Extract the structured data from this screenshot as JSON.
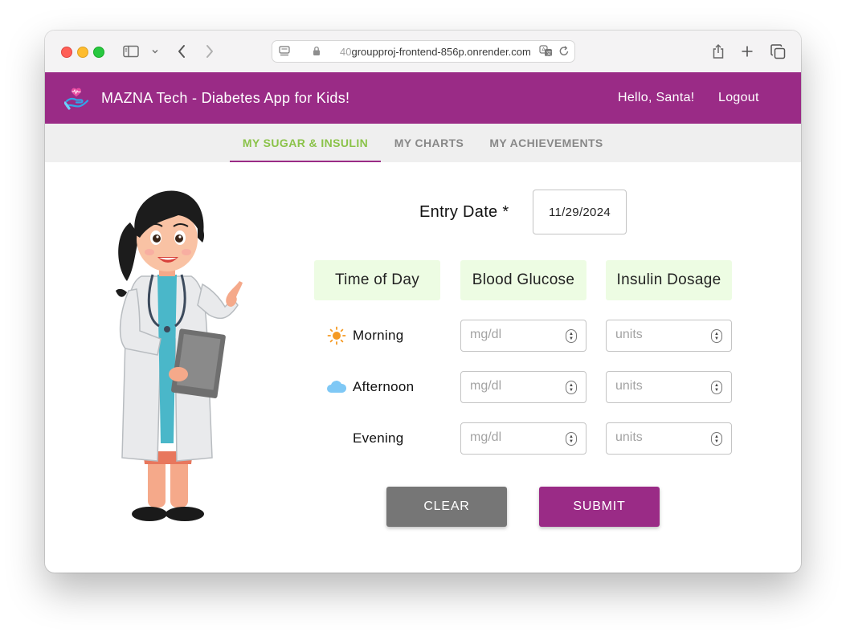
{
  "browser": {
    "url_prefix": "40",
    "url_host": "groupproj-frontend-856p.onrender.com",
    "icons": [
      "sidebar-icon",
      "chevron-down-icon",
      "back-arrow-icon",
      "forward-arrow-icon",
      "page-settings-icon",
      "lock-icon",
      "translate-icon",
      "reload-icon",
      "share-icon",
      "new-tab-icon",
      "tab-overview-icon"
    ]
  },
  "header": {
    "title": "MAZNA Tech - Diabetes App for Kids!",
    "greeting": "Hello, Santa!",
    "logout_label": "Logout",
    "color": "#9a2b86",
    "logo_icon": "heart-in-hand-icon"
  },
  "tabs": [
    {
      "label": "MY SUGAR & INSULIN",
      "active": true
    },
    {
      "label": "MY CHARTS",
      "active": false
    },
    {
      "label": "MY ACHIEVEMENTS",
      "active": false
    }
  ],
  "form": {
    "entry_date_label": "Entry Date *",
    "entry_date_value": "11/29/2024",
    "columns": [
      "Time of Day",
      "Blood Glucose",
      "Insulin Dosage"
    ],
    "rows": [
      {
        "label": "Morning",
        "icon": "sun-icon",
        "glucose_placeholder": "mg/dl",
        "insulin_placeholder": "units"
      },
      {
        "label": "Afternoon",
        "icon": "cloud-icon",
        "glucose_placeholder": "mg/dl",
        "insulin_placeholder": "units"
      },
      {
        "label": "Evening",
        "icon": "moon-icon",
        "glucose_placeholder": "mg/dl",
        "insulin_placeholder": "units"
      }
    ],
    "clear_label": "CLEAR",
    "submit_label": "SUBMIT"
  },
  "illustration": "doctor-illustration",
  "colors": {
    "accent_green": "#8bc34a",
    "column_header_bg": "#edfce3",
    "clear_button": "#767676",
    "submit_button": "#9a2b86"
  }
}
